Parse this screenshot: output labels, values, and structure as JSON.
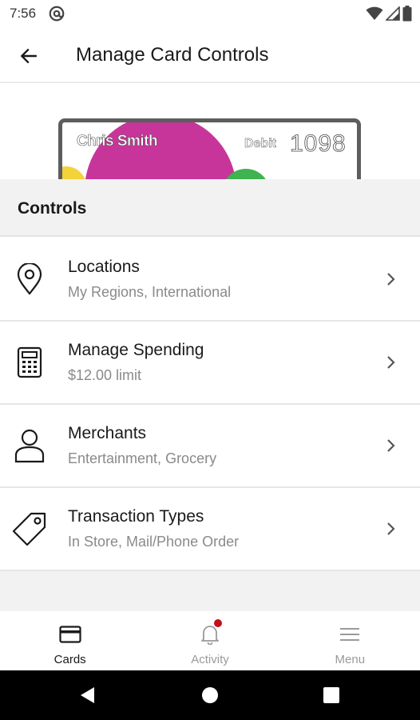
{
  "status_bar": {
    "time": "7:56",
    "icons": [
      "at-sign-icon",
      "wifi-icon",
      "signal-icon",
      "battery-icon"
    ]
  },
  "app_bar": {
    "title": "Manage Card Controls",
    "back_icon": "arrow-left-icon"
  },
  "card": {
    "holder_name": "Chris Smith",
    "type": "Debit",
    "last4": "1098",
    "colors": {
      "pink": "#c8359a",
      "yellow": "#f3d23a",
      "green": "#3fb34f",
      "border": "#5d5d5d"
    }
  },
  "controls": {
    "header": "Controls",
    "items": [
      {
        "title": "Locations",
        "subtitle": "My Regions, International",
        "icon": "location-pin-icon"
      },
      {
        "title": "Manage Spending",
        "subtitle": "$12.00 limit",
        "icon": "calculator-icon"
      },
      {
        "title": "Merchants",
        "subtitle": "Entertainment, Grocery",
        "icon": "person-icon"
      },
      {
        "title": "Transaction Types",
        "subtitle": "In Store, Mail/Phone Order",
        "icon": "tag-icon"
      }
    ]
  },
  "bottom_nav": {
    "items": [
      {
        "label": "Cards",
        "icon": "card-icon",
        "active": true
      },
      {
        "label": "Activity",
        "icon": "bell-icon",
        "active": false,
        "badge": true
      },
      {
        "label": "Menu",
        "icon": "hamburger-menu-icon",
        "active": false
      }
    ],
    "badge_color": "#c40e1e"
  },
  "system_nav": {
    "icons": [
      "back-triangle-icon",
      "home-circle-icon",
      "recents-square-icon"
    ]
  }
}
